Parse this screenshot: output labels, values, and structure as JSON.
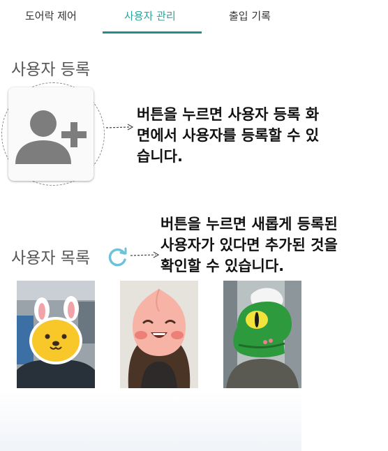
{
  "tabs": [
    {
      "label": "도어락 제어",
      "active": false
    },
    {
      "label": "사용자 관리",
      "active": true
    },
    {
      "label": "출입 기록",
      "active": false
    }
  ],
  "register": {
    "title": "사용자 등록",
    "button_icon": "add-user-icon"
  },
  "annotations": {
    "register_lines": [
      "버튼을 누르면 사용자 등록 화",
      "면에서 사용자를 등록할 수 있",
      "습니다."
    ],
    "list_lines": [
      "버튼을 누르면 새롭게 등록된",
      "사용자가 있다면 추가된 것을",
      "확인할 수 있습니다."
    ]
  },
  "user_list": {
    "title": "사용자 목록",
    "refresh_icon": "refresh-icon",
    "users": [
      {
        "icon": "yellow-bunny-face-icon"
      },
      {
        "icon": "peach-face-icon"
      },
      {
        "icon": "green-dinosaur-face-icon"
      }
    ]
  },
  "colors": {
    "accent": "#2aa39b",
    "indicator": "#1f8f88",
    "refresh": "#6cc3d9"
  }
}
